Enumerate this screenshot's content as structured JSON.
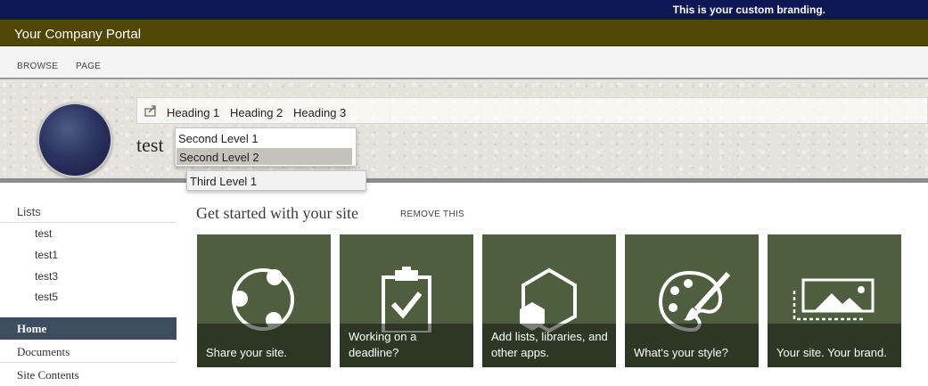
{
  "branding": {
    "text": "This is your custom branding."
  },
  "portal": {
    "title": "Your Company Portal"
  },
  "ribbon": {
    "tabs": [
      "BROWSE",
      "PAGE"
    ]
  },
  "topnav": {
    "items": [
      "Heading 1",
      "Heading 2",
      "Heading 3"
    ],
    "dropdown": [
      "Second Level 1",
      "Second Level 2"
    ],
    "subdropdown": [
      "Third Level 1"
    ]
  },
  "site": {
    "title": "test"
  },
  "quicklaunch": {
    "heading": "Lists",
    "lists": [
      "test",
      "test1",
      "test3",
      "test5"
    ],
    "main": [
      "Home",
      "Documents",
      "Site Contents"
    ]
  },
  "getstarted": {
    "title": "Get started with your site",
    "remove": "REMOVE THIS",
    "tiles": [
      {
        "label": "Share your site.",
        "icon": "share-icon"
      },
      {
        "label": "Working on a deadline?",
        "icon": "clipboard-check-icon"
      },
      {
        "label": "Add lists, libraries, and other apps.",
        "icon": "app-hexagon-icon"
      },
      {
        "label": "What's your style?",
        "icon": "palette-icon"
      },
      {
        "label": "Your site. Your brand.",
        "icon": "image-brand-icon"
      }
    ]
  },
  "colors": {
    "tile": "#4f5e3f",
    "branding": "#0c1754",
    "portal": "#504606",
    "quicklaunch_active": "#3e4e60"
  }
}
